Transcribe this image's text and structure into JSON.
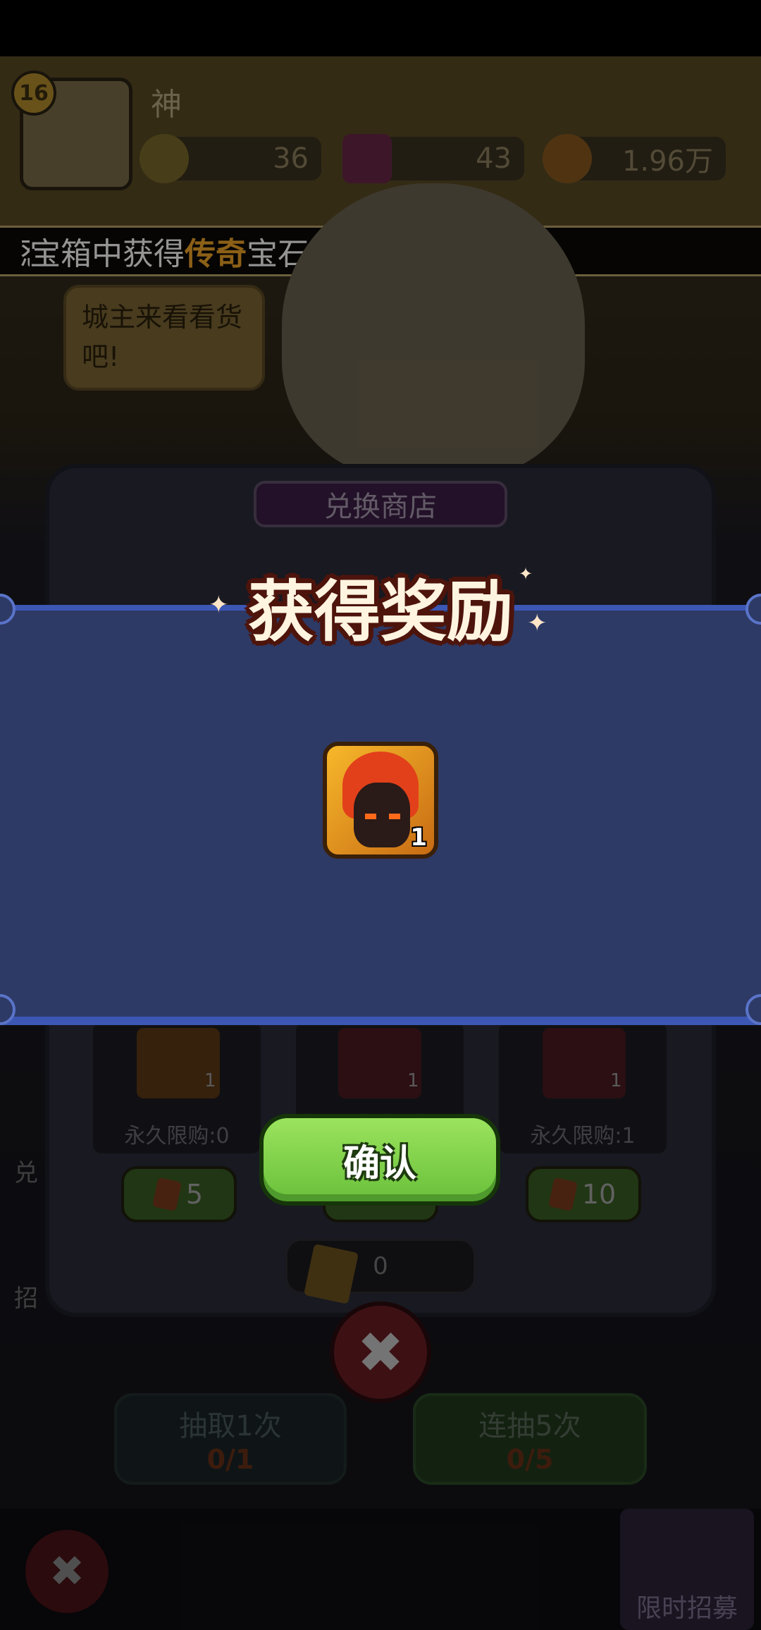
{
  "player": {
    "level": "16",
    "name": "神",
    "currency1": "36",
    "currency2": "43",
    "currency3": "1.96万"
  },
  "marquee": {
    "prefix": "宝箱中获得",
    "highlight": "传奇",
    "suffix": "宝石",
    "lead": "怼"
  },
  "bubble": {
    "text": "城主来看看货吧!"
  },
  "shop": {
    "title": "兑换商店",
    "cards": [
      {
        "limit": "永久限购:0",
        "count": "1",
        "price": "5"
      },
      {
        "limit": "",
        "count": "1",
        "price": ""
      },
      {
        "limit": "永久限购:1",
        "count": "1",
        "price": "10"
      }
    ],
    "currency_amount": "0"
  },
  "draw": {
    "one_label": "抽取1次",
    "one_count": "0/1",
    "five_label": "连抽5次",
    "five_count": "0/5"
  },
  "side": {
    "exchange": "兑",
    "recruit": "招"
  },
  "limited_recruit": "限时招募",
  "reward_dialog": {
    "title": "获得奖励",
    "item_count": "1",
    "confirm_label": "确认"
  },
  "colors": {
    "dialog_bg": "#2d3a66",
    "dialog_border": "#3c57b4",
    "confirm_green": "#7ed04a",
    "highlight_orange": "#f2a628"
  }
}
